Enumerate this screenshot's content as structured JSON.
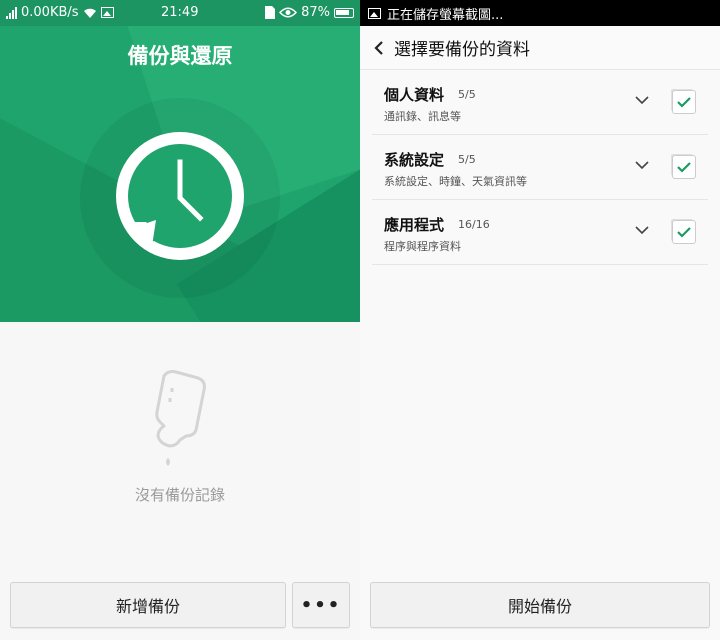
{
  "left": {
    "status_bar": {
      "speed": "0.00KB/s",
      "time": "21:49",
      "battery": "87%"
    },
    "title": "備份與還原",
    "empty_text": "沒有備份記錄",
    "new_backup_label": "新增備份",
    "more_label": "•••"
  },
  "right": {
    "status_bar": {
      "notification": "正在儲存螢幕截圖..."
    },
    "title": "選擇要備份的資料",
    "items": [
      {
        "title": "個人資料",
        "count": "5/5",
        "subtitle": "通訊錄、訊息等",
        "checked": true
      },
      {
        "title": "系統設定",
        "count": "5/5",
        "subtitle": "系統設定、時鐘、天氣資訊等",
        "checked": true
      },
      {
        "title": "應用程式",
        "count": "16/16",
        "subtitle": "程序與程序資料",
        "checked": true
      }
    ],
    "start_backup_label": "開始備份"
  },
  "colors": {
    "brand_green": "#1fa46d",
    "check_green": "#1c9a63"
  },
  "icons": [
    "signal-icon",
    "wifi-icon",
    "image-icon",
    "sim-icon",
    "eye-icon",
    "battery-icon",
    "clock-restore-icon",
    "empty-bottle-icon",
    "back-arrow-icon",
    "chevron-down-icon",
    "checkmark-icon"
  ]
}
